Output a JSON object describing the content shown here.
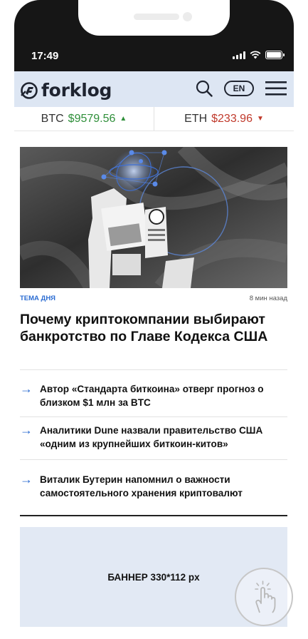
{
  "status_bar": {
    "time": "17:49"
  },
  "header": {
    "logo_text": "forklog",
    "lang": "EN"
  },
  "ticker": {
    "btc": {
      "symbol": "BTC",
      "price": "$9579.56",
      "arrow": "▲"
    },
    "eth": {
      "symbol": "ETH",
      "price": "$233.96",
      "arrow": "▼"
    }
  },
  "hero": {
    "tag": "ТЕМА ДНЯ",
    "time_ago": "8 мин назад",
    "title": "Почему криптокомпании выбирают банкротство по Главе Кодекса США"
  },
  "news": [
    {
      "title": "Автор «Стандарта биткоина» отверг прогноз о близком $1 млн за BTC"
    },
    {
      "title": "Аналитики Dune назвали правительство США «одним из крупнейших биткоин-китов»"
    },
    {
      "title": "Виталик Бутерин напомнил о важности самостоятельного хранения криптовалют"
    }
  ],
  "banner": {
    "label": "БАННЕР 330*112 px"
  },
  "colors": {
    "accent": "#2b6cd2",
    "header_bg": "#dde6f3",
    "up": "#2f8f3a",
    "down": "#c0392b"
  },
  "icons": [
    "search-icon",
    "menu-icon",
    "arrow-right-icon",
    "tap-gesture-icon",
    "signal-icon",
    "wifi-icon",
    "battery-icon"
  ]
}
